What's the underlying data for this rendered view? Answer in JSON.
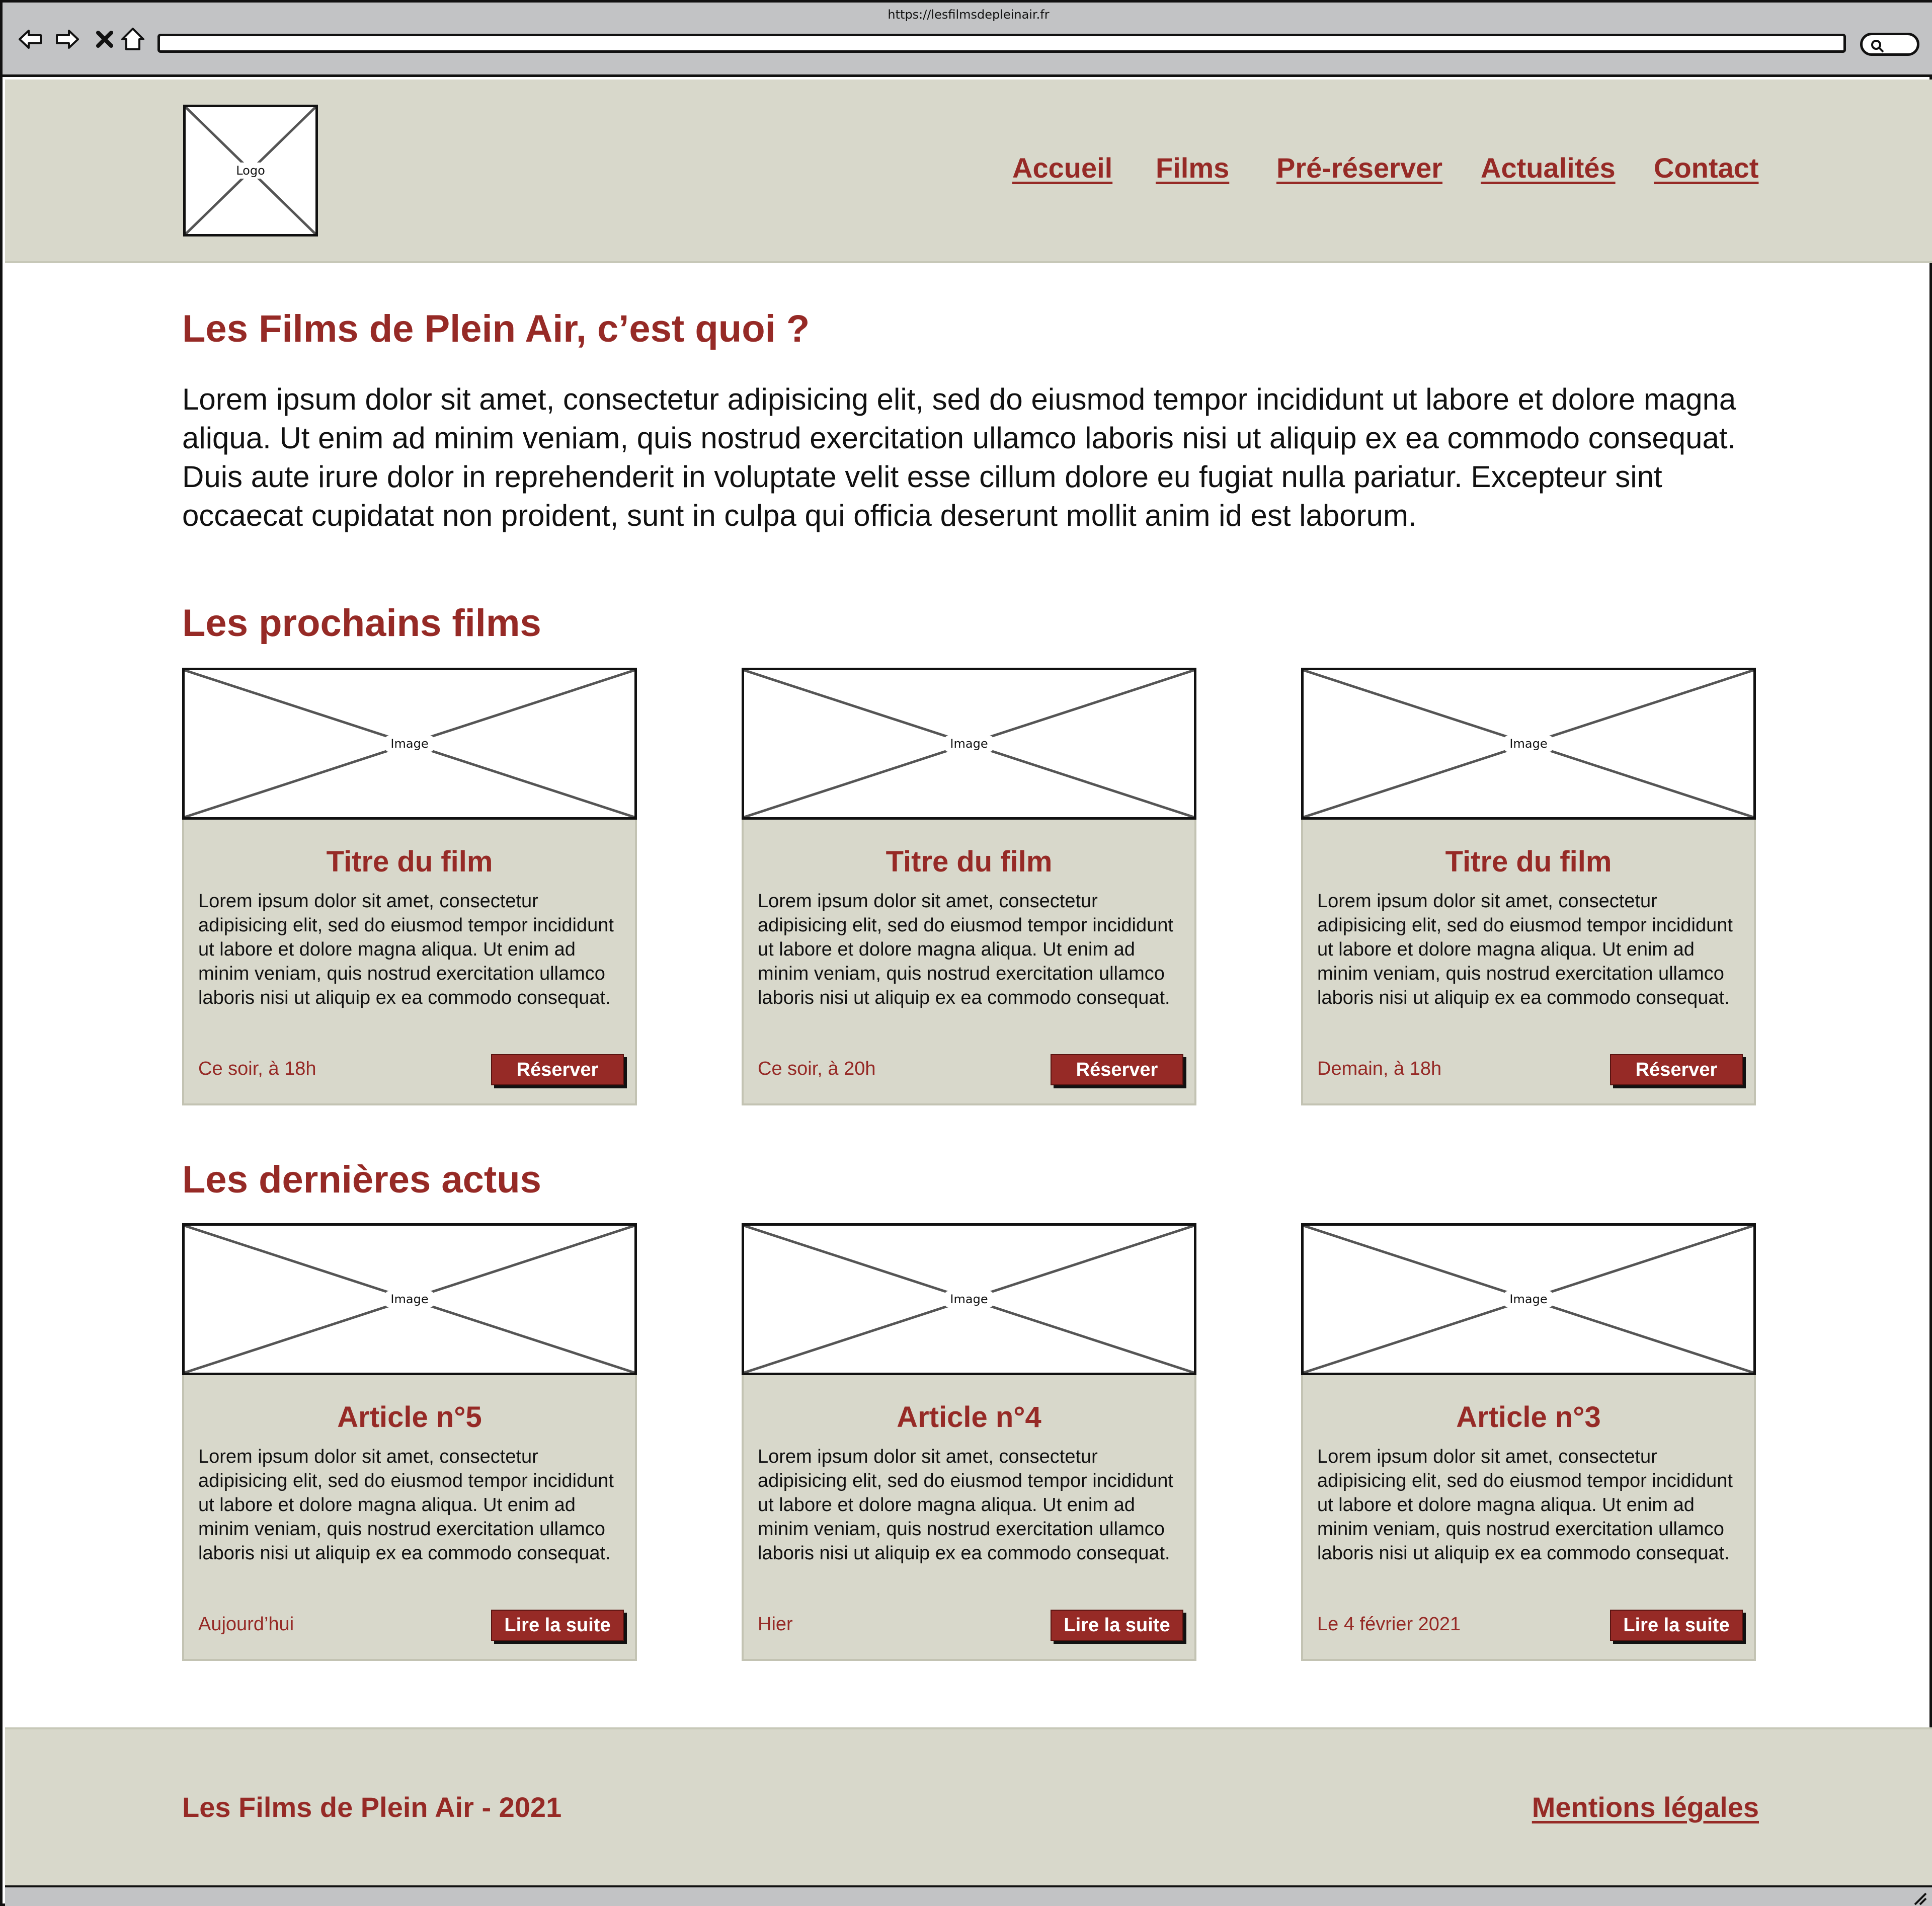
{
  "browser": {
    "url": "https://lesfilmsdepleinair.fr"
  },
  "header": {
    "logo_label": "Logo",
    "nav": [
      "Accueil",
      "Films",
      "Pré-réserver",
      "Actualités",
      "Contact"
    ]
  },
  "intro": {
    "title": "Les Films de Plein Air, c’est quoi ?",
    "text": "Lorem ipsum dolor sit amet, consectetur adipisicing elit, sed do eiusmod tempor incididunt ut labore et dolore magna aliqua. Ut enim ad minim veniam, quis nostrud exercitation ullamco laboris nisi ut aliquip ex ea commodo consequat. Duis aute irure dolor in reprehenderit in voluptate velit esse cillum dolore eu fugiat nulla pariatur. Excepteur sint occaecat cupidatat non proident, sunt in culpa qui officia deserunt mollit anim id est laborum."
  },
  "films": {
    "title": "Les prochains films",
    "items": [
      {
        "image_label": "Image",
        "title": "Titre du film",
        "text": "Lorem ipsum dolor sit amet, consectetur adipisicing elit, sed do eiusmod tempor incididunt ut labore et dolore magna aliqua. Ut enim ad minim veniam, quis nostrud exercitation ullamco laboris nisi ut aliquip ex ea commodo consequat.",
        "meta": "Ce soir, à 18h",
        "button": "Réserver"
      },
      {
        "image_label": "Image",
        "title": "Titre du film",
        "text": "Lorem ipsum dolor sit amet, consectetur adipisicing elit, sed do eiusmod tempor incididunt ut labore et dolore magna aliqua. Ut enim ad minim veniam, quis nostrud exercitation ullamco laboris nisi ut aliquip ex ea commodo consequat.",
        "meta": "Ce soir, à 20h",
        "button": "Réserver"
      },
      {
        "image_label": "Image",
        "title": "Titre du film",
        "text": "Lorem ipsum dolor sit amet, consectetur adipisicing elit, sed do eiusmod tempor incididunt ut labore et dolore magna aliqua. Ut enim ad minim veniam, quis nostrud exercitation ullamco laboris nisi ut aliquip ex ea commodo consequat.",
        "meta": "Demain, à 18h",
        "button": "Réserver"
      }
    ]
  },
  "news": {
    "title": "Les dernières actus",
    "items": [
      {
        "image_label": "Image",
        "title": "Article n°5",
        "text": "Lorem ipsum dolor sit amet, consectetur adipisicing elit, sed do eiusmod tempor incididunt ut labore et dolore magna aliqua. Ut enim ad minim veniam, quis nostrud exercitation ullamco laboris nisi ut aliquip ex ea commodo consequat.",
        "meta": "Aujourd’hui",
        "button": "Lire la suite"
      },
      {
        "image_label": "Image",
        "title": "Article n°4",
        "text": "Lorem ipsum dolor sit amet, consectetur adipisicing elit, sed do eiusmod tempor incididunt ut labore et dolore magna aliqua. Ut enim ad minim veniam, quis nostrud exercitation ullamco laboris nisi ut aliquip ex ea commodo consequat.",
        "meta": "Hier",
        "button": "Lire la suite"
      },
      {
        "image_label": "Image",
        "title": "Article n°3",
        "text": "Lorem ipsum dolor sit amet, consectetur adipisicing elit, sed do eiusmod tempor incididunt ut labore et dolore magna aliqua. Ut enim ad minim veniam, quis nostrud exercitation ullamco laboris nisi ut aliquip ex ea commodo consequat.",
        "meta": "Le 4 février 2021",
        "button": "Lire la suite"
      }
    ]
  },
  "footer": {
    "copyright": "Les Films de Plein Air - 2021",
    "legal_link": "Mentions légales"
  },
  "colors": {
    "accent": "#962a26",
    "panel": "#d8d8cb",
    "chrome": "#c2c3c5"
  }
}
